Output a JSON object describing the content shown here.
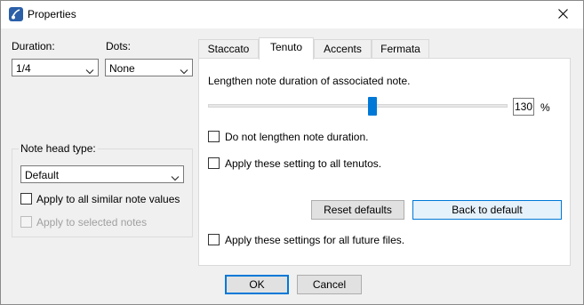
{
  "window": {
    "title": "Properties"
  },
  "icons": {
    "app": "app-logo-icon",
    "close": "close-icon",
    "dropdown": "chevron-down-icon"
  },
  "left": {
    "duration": {
      "label": "Duration:",
      "value": "1/4"
    },
    "dots": {
      "label": "Dots:",
      "value": "None"
    },
    "note_head": {
      "title": "Note head type:",
      "value": "Default",
      "apply_similar": {
        "label": "Apply to all similar note values",
        "checked": false,
        "enabled": true
      },
      "apply_selected": {
        "label": "Apply to selected notes",
        "checked": false,
        "enabled": false
      }
    }
  },
  "tabs": [
    {
      "label": "Staccato",
      "active": false
    },
    {
      "label": "Tenuto",
      "active": true
    },
    {
      "label": "Accents",
      "active": false
    },
    {
      "label": "Fermata",
      "active": false
    }
  ],
  "tenuto": {
    "description": "Lengthen note duration of associated note.",
    "slider": {
      "value": 130,
      "min": 100,
      "max": 200,
      "fraction": 0.55
    },
    "percent_value": "130",
    "percent_sign": "%",
    "dont_lengthen": {
      "label": "Do not lengthen note duration.",
      "checked": false
    },
    "apply_all_tenutos": {
      "label": "Apply these setting to all tenutos.",
      "checked": false
    },
    "reset_button": "Reset defaults",
    "back_button": "Back to default",
    "future_files": {
      "label": "Apply these settings for all future files.",
      "checked": false
    }
  },
  "footer": {
    "ok": "OK",
    "cancel": "Cancel"
  },
  "colors": {
    "accent": "#0078d7",
    "dialog_bg": "#f0f0f0",
    "panel_bg": "#ffffff"
  }
}
